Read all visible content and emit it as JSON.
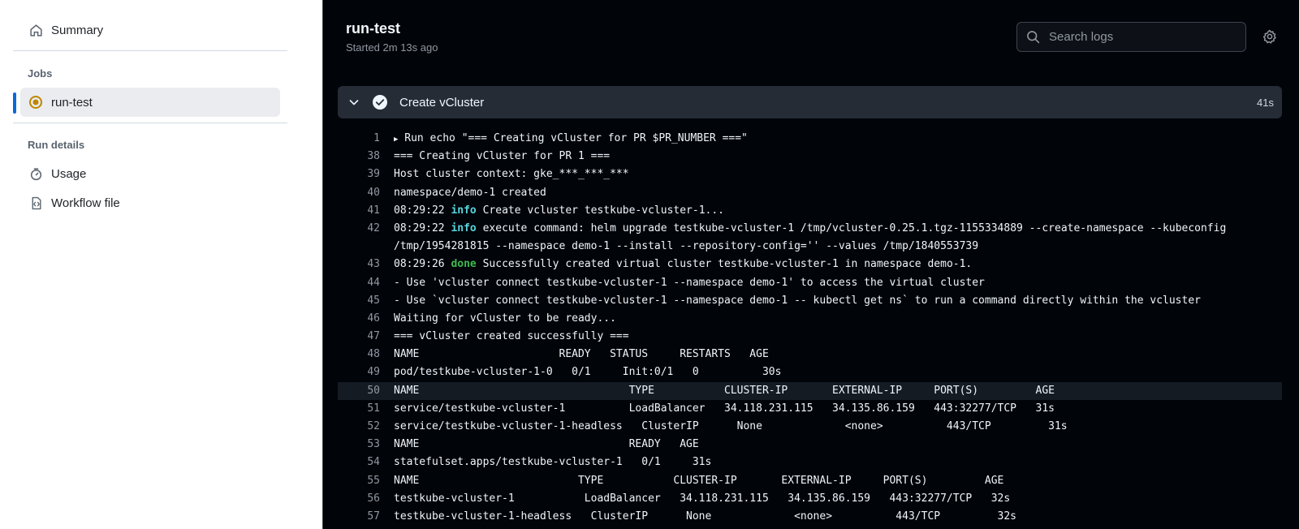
{
  "sidebar": {
    "summary": "Summary",
    "jobs_heading": "Jobs",
    "job_name": "run-test",
    "run_details_heading": "Run details",
    "usage": "Usage",
    "workflow_file": "Workflow file"
  },
  "header": {
    "title": "run-test",
    "subtitle": "Started 2m 13s ago",
    "search_placeholder": "Search logs"
  },
  "step": {
    "name": "Create vCluster",
    "duration": "41s"
  },
  "log": [
    {
      "n": "1",
      "caret": "▶",
      "text": " Run echo \"=== Creating vCluster for PR $PR_NUMBER ===\""
    },
    {
      "n": "38",
      "text": "=== Creating vCluster for PR 1 ==="
    },
    {
      "n": "39",
      "text": "Host cluster context: gke_***_***_***"
    },
    {
      "n": "40",
      "text": "namespace/demo-1 created"
    },
    {
      "n": "41",
      "time": "08:29:22",
      "level": "info",
      "text": " Create vcluster testkube-vcluster-1..."
    },
    {
      "n": "42",
      "time": "08:29:22",
      "level": "info",
      "text": " execute command: helm upgrade testkube-vcluster-1 /tmp/vcluster-0.25.1.tgz-1155334889 --create-namespace --kubeconfig /tmp/1954281815 --namespace demo-1 --install --repository-config='' --values /tmp/1840553739",
      "wrap": true
    },
    {
      "n": "43",
      "time": "08:29:26",
      "level": "done",
      "text": " Successfully created virtual cluster testkube-vcluster-1 in namespace demo-1."
    },
    {
      "n": "44",
      "text": "- Use 'vcluster connect testkube-vcluster-1 --namespace demo-1' to access the virtual cluster"
    },
    {
      "n": "45",
      "text": "- Use `vcluster connect testkube-vcluster-1 --namespace demo-1 -- kubectl get ns` to run a command directly within the vcluster"
    },
    {
      "n": "46",
      "text": "Waiting for vCluster to be ready..."
    },
    {
      "n": "47",
      "text": "=== vCluster created successfully ==="
    },
    {
      "n": "48",
      "text": "NAME                      READY   STATUS     RESTARTS   AGE"
    },
    {
      "n": "49",
      "text": "pod/testkube-vcluster-1-0   0/1     Init:0/1   0          30s"
    },
    {
      "n": "50",
      "text": "NAME                                 TYPE           CLUSTER-IP       EXTERNAL-IP     PORT(S)         AGE",
      "highlight": true
    },
    {
      "n": "51",
      "text": "service/testkube-vcluster-1          LoadBalancer   34.118.231.115   34.135.86.159   443:32277/TCP   31s"
    },
    {
      "n": "52",
      "text": "service/testkube-vcluster-1-headless   ClusterIP      None             <none>          443/TCP         31s"
    },
    {
      "n": "53",
      "text": "NAME                                 READY   AGE"
    },
    {
      "n": "54",
      "text": "statefulset.apps/testkube-vcluster-1   0/1     31s"
    },
    {
      "n": "55",
      "text": "NAME                         TYPE           CLUSTER-IP       EXTERNAL-IP     PORT(S)         AGE"
    },
    {
      "n": "56",
      "text": "testkube-vcluster-1           LoadBalancer   34.118.231.115   34.135.86.159   443:32277/TCP   32s"
    },
    {
      "n": "57",
      "text": "testkube-vcluster-1-headless   ClusterIP      None             <none>          443/TCP         32s"
    }
  ]
}
